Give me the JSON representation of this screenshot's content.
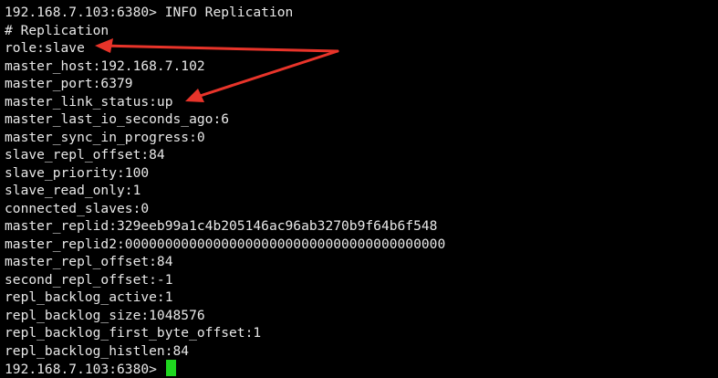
{
  "terminal": {
    "command_prompt": "192.168.7.103:6380> ",
    "command": "INFO Replication",
    "section_header": "# Replication",
    "lines": [
      "role:slave",
      "master_host:192.168.7.102",
      "master_port:6379",
      "master_link_status:up",
      "master_last_io_seconds_ago:6",
      "master_sync_in_progress:0",
      "slave_repl_offset:84",
      "slave_priority:100",
      "slave_read_only:1",
      "connected_slaves:0",
      "master_replid:329eeb99a1c4b205146ac96ab3270b9f64b6f548",
      "master_replid2:0000000000000000000000000000000000000000",
      "master_repl_offset:84",
      "second_repl_offset:-1",
      "repl_backlog_active:1",
      "repl_backlog_size:1048576",
      "repl_backlog_first_byte_offset:1",
      "repl_backlog_histlen:84"
    ],
    "final_prompt": "192.168.7.103:6380> ",
    "colors": {
      "background": "#000000",
      "text": "#e8e8e8",
      "cursor": "#1fd61f",
      "annotation_arrow": "#e8342a"
    }
  }
}
